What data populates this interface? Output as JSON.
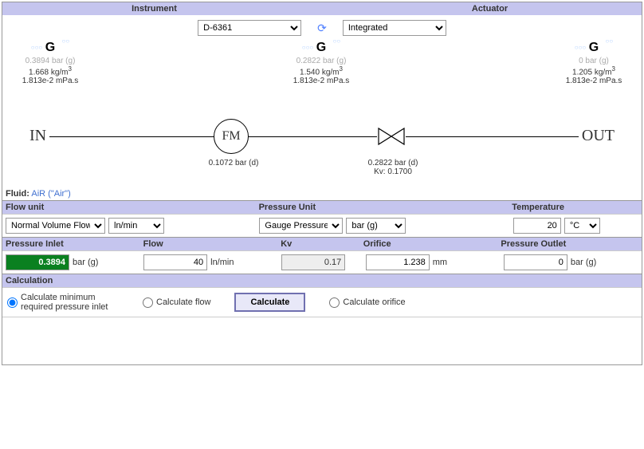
{
  "header": {
    "instrument_label": "Instrument",
    "actuator_label": "Actuator",
    "instrument_value": "D-6361",
    "actuator_value": "Integrated"
  },
  "gas_points": {
    "inlet": {
      "pressure": "0.3894 bar (g)",
      "density": "1.668 kg/m",
      "viscosity": "1.813e-2 mPa.s"
    },
    "mid": {
      "pressure": "0.2822 bar (g)",
      "density": "1.540 kg/m",
      "viscosity": "1.813e-2 mPa.s"
    },
    "outlet": {
      "pressure": "0 bar (g)",
      "density": "1.205 kg/m",
      "viscosity": "1.813e-2 mPa.s"
    }
  },
  "pipe": {
    "in": "IN",
    "out": "OUT",
    "fm": "FM",
    "fm_label": "0.1072 bar (d)",
    "valve_label1": "0.2822 bar (d)",
    "valve_label2": "Kv: 0.1700"
  },
  "fluid": {
    "label": "Fluid:",
    "value": "AiR (\"Air\")"
  },
  "units": {
    "flow_unit_label": "Flow unit",
    "pressure_unit_label": "Pressure Unit",
    "temperature_label": "Temperature",
    "flow_unit_type": "Normal Volume Flow",
    "flow_unit": "ln/min",
    "pressure_type": "Gauge Pressure",
    "pressure_unit": "bar (g)",
    "temperature_value": "20",
    "temperature_unit": "°C"
  },
  "params": {
    "pressure_inlet_label": "Pressure Inlet",
    "flow_label": "Flow",
    "kv_label": "Kv",
    "orifice_label": "Orifice",
    "pressure_outlet_label": "Pressure Outlet",
    "pressure_inlet_value": "0.3894",
    "pressure_inlet_unit": "bar (g)",
    "flow_value": "40",
    "flow_unit": "ln/min",
    "kv_value": "0.17",
    "orifice_value": "1.238",
    "orifice_unit": "mm",
    "pressure_outlet_value": "0",
    "pressure_outlet_unit": "bar (g)"
  },
  "calculation": {
    "header": "Calculation",
    "opt_min_inlet": "Calculate minimum required pressure inlet",
    "opt_flow": "Calculate flow",
    "opt_orifice": "Calculate orifice",
    "button": "Calculate"
  }
}
